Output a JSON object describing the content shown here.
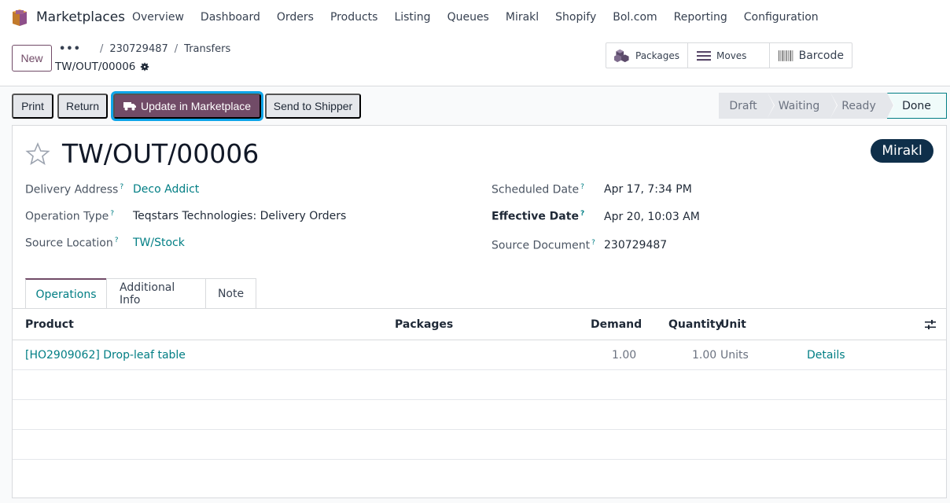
{
  "navbar": {
    "app_name": "Marketplaces",
    "menu": [
      "Overview",
      "Dashboard",
      "Orders",
      "Products",
      "Listing",
      "Queues",
      "Mirakl",
      "Shopify",
      "Bol.com",
      "Reporting",
      "Configuration"
    ]
  },
  "control_panel": {
    "new_label": "New",
    "breadcrumb": [
      "•••",
      "230729487",
      "Transfers"
    ],
    "current_record": "TW/OUT/00006",
    "smart_buttons": {
      "packages": "Packages",
      "moves": "Moves",
      "barcode": "Barcode"
    }
  },
  "actions": {
    "print": "Print",
    "return": "Return",
    "update_marketplace": "Update in Marketplace",
    "send_shipper": "Send to Shipper"
  },
  "status": {
    "stages": [
      "Draft",
      "Waiting",
      "Ready",
      "Done"
    ],
    "current": "Done"
  },
  "record": {
    "name": "TW/OUT/00006",
    "tag": "Mirakl",
    "fields": {
      "delivery_address_label": "Delivery Address",
      "delivery_address": "Deco Addict",
      "operation_type_label": "Operation Type",
      "operation_type": "Teqstars Technologies: Delivery Orders",
      "source_location_label": "Source Location",
      "source_location": "TW/Stock",
      "scheduled_date_label": "Scheduled Date",
      "scheduled_date": "Apr 17, 7:34 PM",
      "effective_date_label": "Effective Date",
      "effective_date": "Apr 20, 10:03 AM",
      "source_document_label": "Source Document",
      "source_document": "230729487"
    },
    "help_mark": "?"
  },
  "tabs": [
    "Operations",
    "Additional Info",
    "Note"
  ],
  "table": {
    "headers": {
      "product": "Product",
      "packages": "Packages",
      "demand": "Demand",
      "quantity": "Quantity",
      "unit": "Unit"
    },
    "rows": [
      {
        "product": "[HO2909062] Drop-leaf table",
        "demand": "1.00",
        "quantity": "1.00",
        "unit": "Units",
        "details": "Details"
      }
    ]
  },
  "colors": {
    "brand": "#714b67",
    "link": "#017e84",
    "focus": "#0ea5e9",
    "tag": "#0f2f4a"
  }
}
